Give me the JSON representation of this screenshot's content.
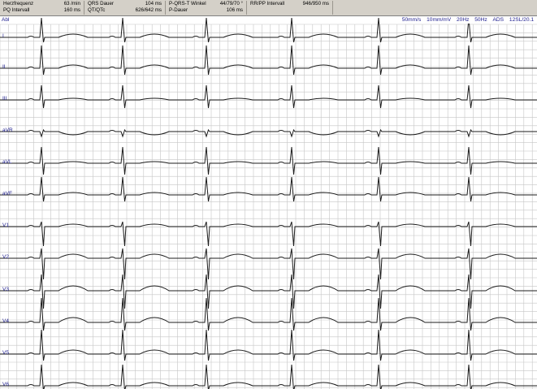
{
  "header": {
    "heart_rate": {
      "label": "Herzfrequenz",
      "value": "63 /min"
    },
    "pq": {
      "label": "PQ Intervall",
      "value": "160 ms"
    },
    "qrs": {
      "label": "QRS Dauer",
      "value": "104 ms"
    },
    "qt": {
      "label": "QT/QTc",
      "value": "626/642 ms"
    },
    "axis": {
      "label": "P-QRS-T Winkel",
      "value": "44/79/70 °"
    },
    "p_duration": {
      "label": "P-Dauer",
      "value": "106 ms"
    },
    "rr": {
      "label": "RR/PP Intervall",
      "value": "946/950 ms"
    }
  },
  "settings": {
    "speed": "50mm/s",
    "gain": "10mm/mV",
    "filter_hp": "20Hz",
    "filter_mains": "50Hz",
    "mode": "ADS",
    "device": "12SL/20.1"
  },
  "leads": [
    "I",
    "II",
    "III",
    "aVR",
    "aVL",
    "aVF",
    "V1",
    "V2",
    "V3",
    "V4",
    "V5",
    "V6"
  ],
  "abl_label": "Abl",
  "colors": {
    "background": "#ffffff",
    "grid": "#c6c6c6",
    "trace": "#1c1c1c",
    "label": "#1a1a8c",
    "panel": "#d4d0c8"
  }
}
